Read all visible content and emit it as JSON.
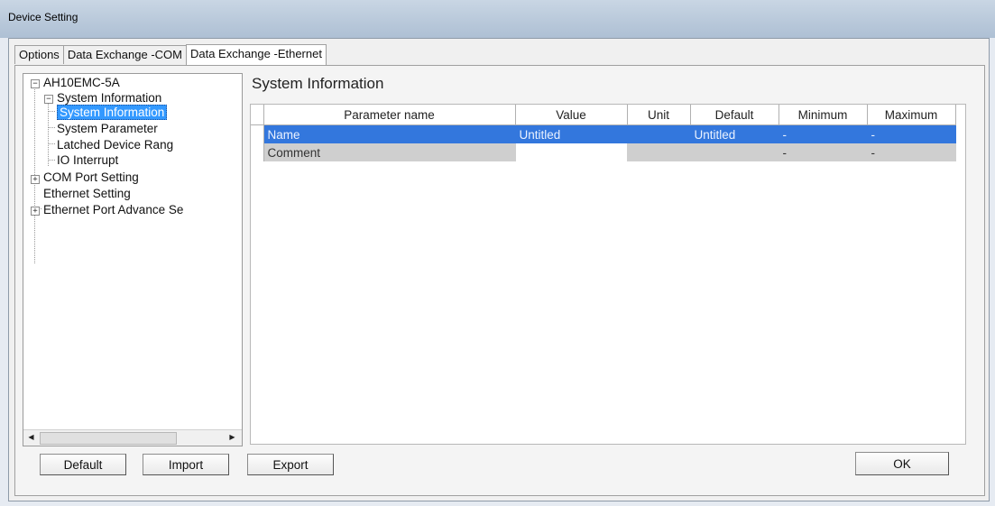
{
  "window": {
    "title": "Device Setting"
  },
  "tabs": [
    {
      "label": "Options",
      "active": false
    },
    {
      "label": "Data Exchange -COM",
      "active": false
    },
    {
      "label": "Data Exchange -Ethernet",
      "active": true
    }
  ],
  "tree": {
    "root": "AH10EMC-5A",
    "items": [
      {
        "label": "System Information",
        "expander": "−"
      },
      {
        "label": "System Information",
        "selected": true
      },
      {
        "label": "System Parameter"
      },
      {
        "label": "Latched Device Rang"
      },
      {
        "label": "IO Interrupt"
      },
      {
        "label": "COM Port Setting",
        "expander": "+"
      },
      {
        "label": "Ethernet Setting"
      },
      {
        "label": "Ethernet Port Advance Se",
        "expander": "+"
      }
    ]
  },
  "panel": {
    "title": "System Information"
  },
  "table": {
    "columns": [
      "Parameter name",
      "Value",
      "Unit",
      "Default",
      "Minimum",
      "Maximum"
    ],
    "rows": [
      [
        "Name",
        "Untitled",
        "",
        "Untitled",
        "-",
        "-"
      ],
      [
        "Comment",
        "",
        "",
        "",
        "-",
        "-"
      ]
    ]
  },
  "buttons": {
    "default": "Default",
    "import": "Import",
    "export": "Export",
    "ok": "OK"
  },
  "colors": {
    "selection": "#3377dd",
    "tree_selection": "#3399ff"
  }
}
